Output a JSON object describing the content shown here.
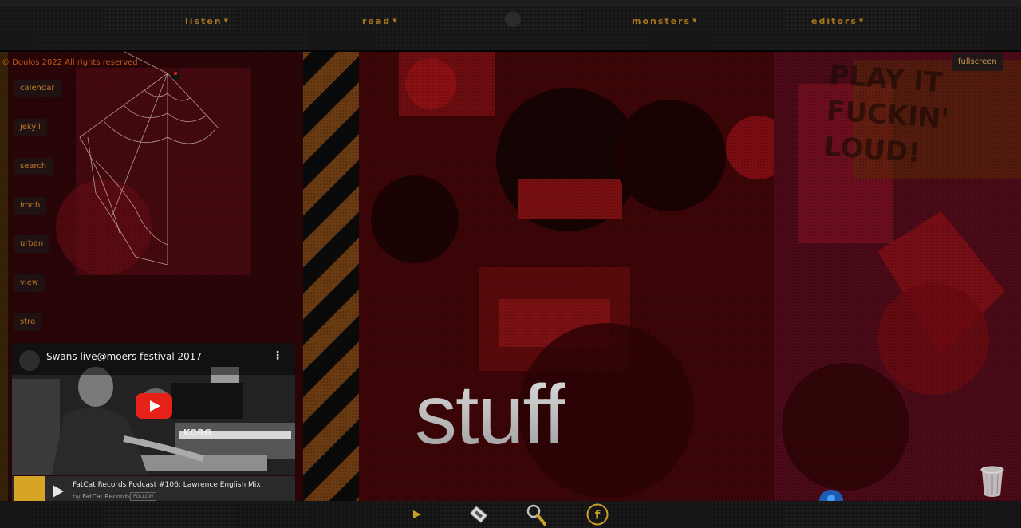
{
  "nav": {
    "items": [
      {
        "label": "listen"
      },
      {
        "label": "read"
      },
      {
        "label": "monsters"
      },
      {
        "label": "editors"
      }
    ]
  },
  "copyright": "© Doulos 2022 All rights reserved",
  "side_menu": [
    "calendar",
    "jekyll",
    "search",
    "imdb",
    "urban",
    "view",
    "stra"
  ],
  "fullscreen_label": "fullscreen",
  "poster_text": [
    "PLAY IT",
    "FUCKIN'",
    "LOUD!"
  ],
  "hero_word": "stuff",
  "video": {
    "title": "Swans live@moers festival 2017"
  },
  "soundcloud": {
    "title": "FatCat Records Podcast #106: Lawrence English Mix",
    "by": "by",
    "artist": "FatCat Records",
    "follow": "FOLLOW"
  },
  "colors": {
    "accent": "#a8741d",
    "background_red": "#5a0a0c",
    "youtube_red": "#e62117"
  },
  "icons": [
    "play-icon",
    "razor-icon",
    "magnifier-icon",
    "facebook-icon",
    "trash-icon",
    "spider-web-icon"
  ]
}
